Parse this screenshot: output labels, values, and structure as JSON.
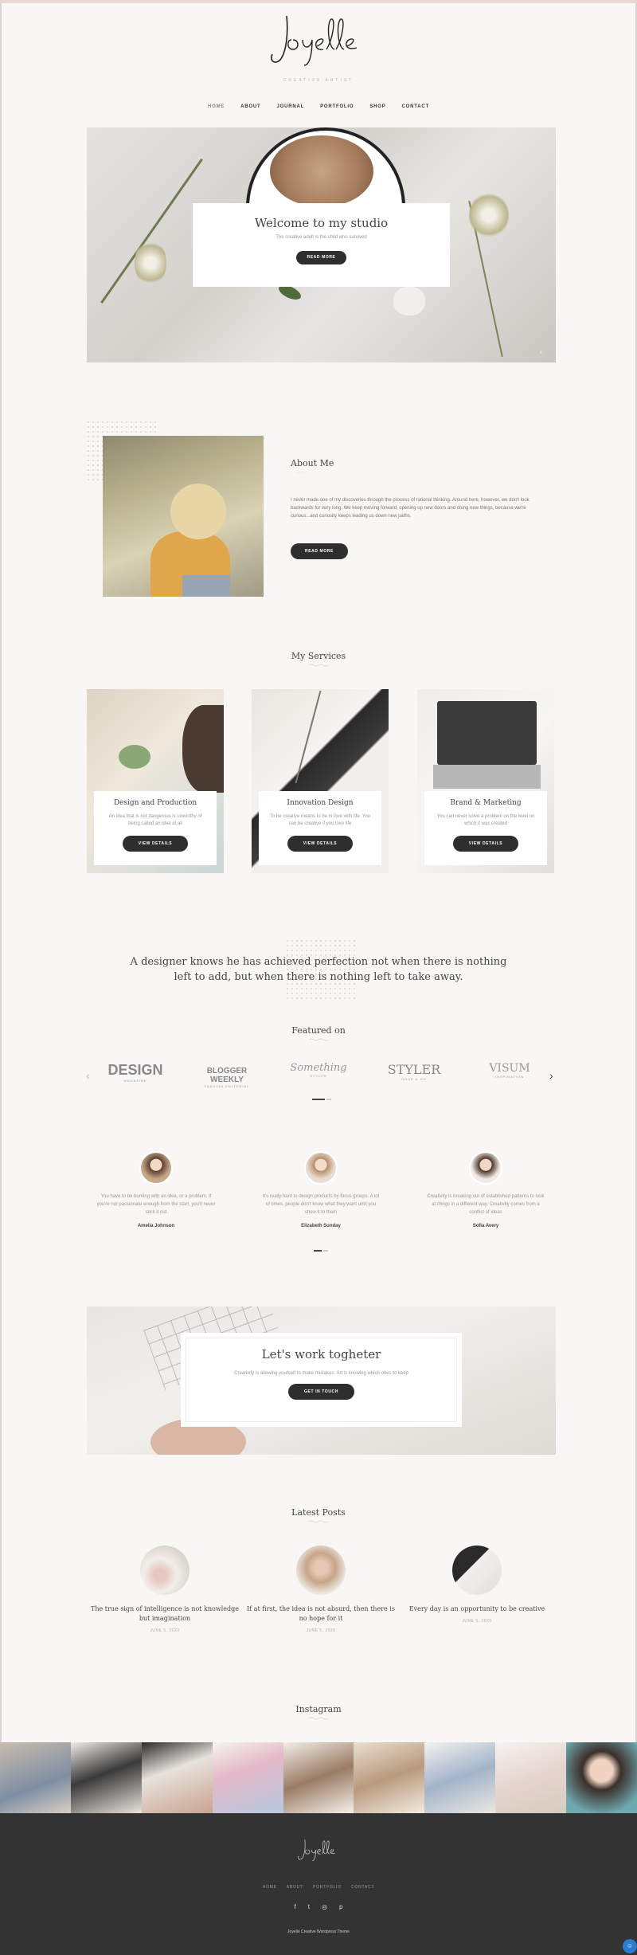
{
  "header": {
    "logo_text": "Joyelle",
    "tagline": "CREATIVE ARTIST",
    "nav": [
      "HOME",
      "ABOUT",
      "JOURNAL",
      "PORTFOLIO",
      "SHOP",
      "CONTACT"
    ],
    "active_nav": "HOME"
  },
  "hero": {
    "title": "Welcome to my studio",
    "subtitle": "The creative adult is the child who survived",
    "button": "READ MORE",
    "arrow": "›"
  },
  "about": {
    "title": "About Me",
    "text": "I never made one of my discoveries through the process of rational thinking. Around here, however, we don't look backwards for very long. We keep moving forward, opening up new doors and doing new things, because we're curious...and curiosity keeps leading us down new paths.",
    "button": "READ MORE"
  },
  "services": {
    "title": "My Services",
    "items": [
      {
        "title": "Design and Production",
        "text": "An idea that is not dangerous is unworthy of being called an idea at all",
        "button": "VIEW DETAILS"
      },
      {
        "title": "Innovation Design",
        "text": "To be creative means to be in love with life. You can be creative if you love life",
        "button": "VIEW DETAILS"
      },
      {
        "title": "Brand & Marketing",
        "text": "You can never solve a problem on the level on which it was created",
        "button": "VIEW DETAILS"
      }
    ]
  },
  "quote": "A designer knows he has achieved perfection not when there is nothing left to add, but when there is nothing left to take away.",
  "featured": {
    "title": "Featured on",
    "logos": [
      {
        "name": "DESIGN",
        "sub": "MAGAZINE"
      },
      {
        "name": "BLOGGER WEEKLY",
        "sub": "FASHION EDITORIAL"
      },
      {
        "name": "Something",
        "sub": "STYLER"
      },
      {
        "name": "STYLER",
        "sub": "SHOP & GO"
      },
      {
        "name": "VISUM",
        "sub": "INSPIRATION"
      }
    ],
    "prev": "‹",
    "next": "›"
  },
  "testimonials": [
    {
      "text": "You have to be burning with an idea, or a problem. If you're not passionate enough from the start, you'll never stick it out",
      "name": "Amelia Johnson"
    },
    {
      "text": "It's really hard to design products by focus groups. A lot of times, people don't know what they want until you show it to them",
      "name": "Elizabeth Sunday"
    },
    {
      "text": "Creativity is breaking out of established patterns to look at things in a different way. Creativity comes from a conflict of ideas",
      "name": "Sofia Avery"
    }
  ],
  "cta": {
    "title": "Let's work togheter",
    "subtitle": "Creativity is allowing yourself to make mistakes. Art is knowing which ones to keep",
    "button": "GET IN TOUCH"
  },
  "posts": {
    "title": "Latest Posts",
    "items": [
      {
        "title": "The true sign of intelligence is not knowledge but imagination",
        "date": "JUNE 5, 2020"
      },
      {
        "title": "If at first, the idea is not absurd, then there is no hope for it",
        "date": "JUNE 5, 2020"
      },
      {
        "title": "Every day is an opportunity to be creative",
        "date": "JUNE 5, 2020"
      }
    ]
  },
  "instagram": {
    "title": "Instagram"
  },
  "footer": {
    "logo_text": "Joyelle",
    "nav": [
      "HOME",
      "ABOUT",
      "PORTFOLIO",
      "CONTACT"
    ],
    "social": [
      "f",
      "t",
      "◎",
      "p"
    ],
    "copyright": "Joyelle Creative Wordpress Theme"
  },
  "colors": {
    "background": "#f9f7f5",
    "dark": "#2e2e2e",
    "accent_pink": "#e6d8d6",
    "footer": "#333333"
  }
}
